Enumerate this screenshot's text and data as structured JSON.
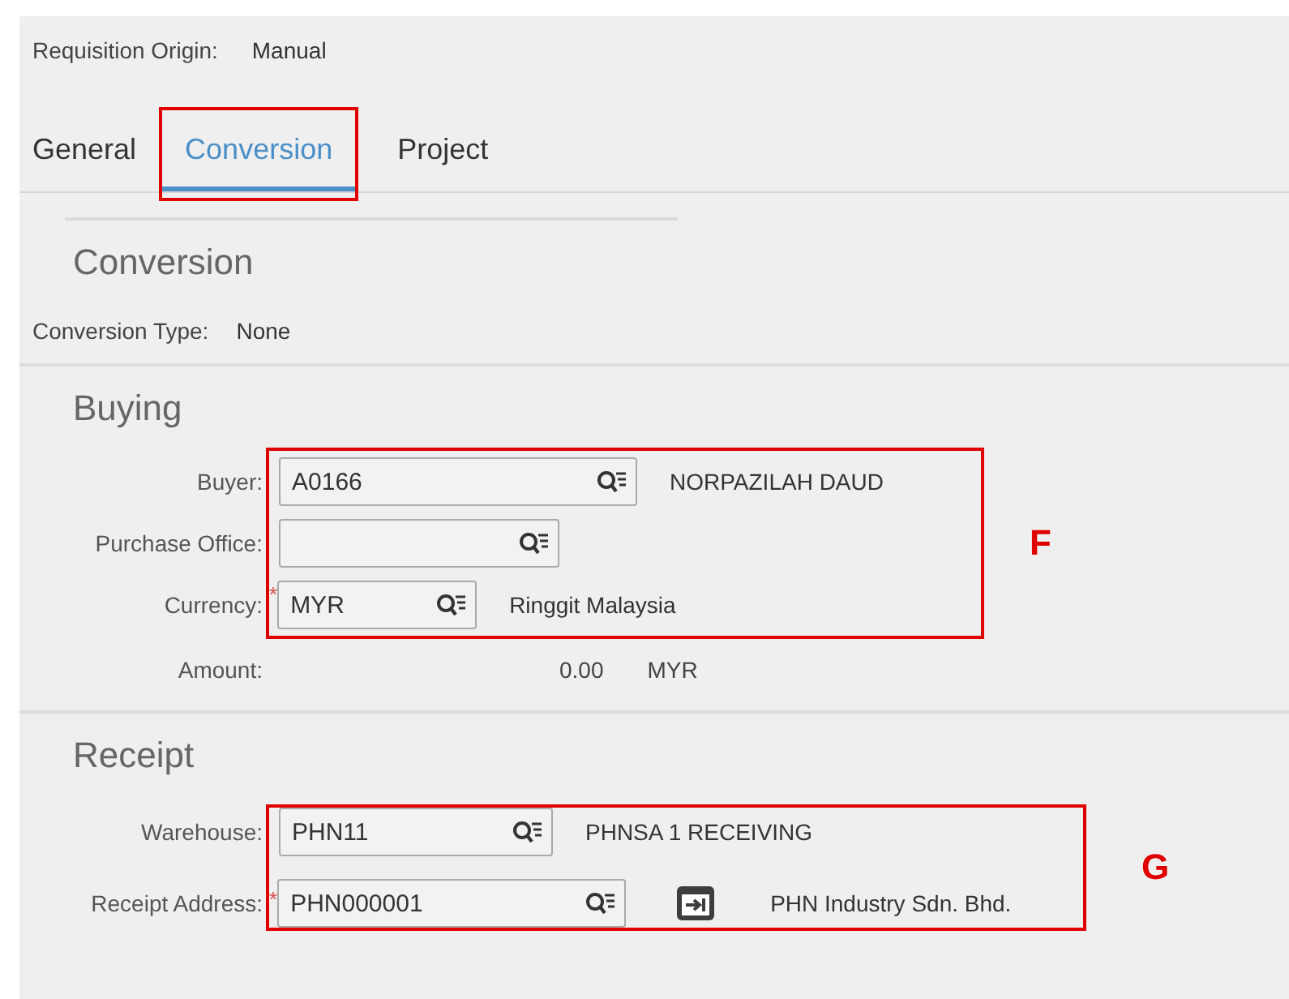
{
  "header": {
    "label": "Requisition Origin:",
    "value": "Manual"
  },
  "tabs": [
    {
      "label": "General",
      "selected": false,
      "highlighted": false
    },
    {
      "label": "Conversion",
      "selected": true,
      "highlighted": true
    },
    {
      "label": "Project",
      "selected": false,
      "highlighted": false
    }
  ],
  "conversion": {
    "title": "Conversion",
    "type_label": "Conversion Type:",
    "type_value": "None"
  },
  "sections": [
    {
      "title": "Buying",
      "annotation": "F",
      "annotated_rows": [
        {
          "kind": "lookup",
          "label": "Buyer:",
          "value": "A0166",
          "description": "NORPAZILAH DAUD"
        },
        {
          "kind": "lookup",
          "label": "Purchase Office:",
          "value": ""
        },
        {
          "kind": "lookup",
          "label": "Currency:",
          "required_mark": "*",
          "value": "MYR",
          "description": "Ringgit Malaysia"
        }
      ],
      "rows": [
        {
          "kind": "amount",
          "label": "Amount:",
          "value": "0.00",
          "unit": "MYR"
        }
      ]
    },
    {
      "title": "Receipt",
      "annotation": "G",
      "annotated_rows": [
        {
          "kind": "lookup",
          "label": "Warehouse:",
          "value": "PHN11",
          "description": "PHNSA 1 RECEIVING"
        },
        {
          "kind": "lookup",
          "label": "Receipt Address:",
          "required_mark": "*",
          "value": "PHN000001",
          "description": "PHN Industry Sdn. Bhd.",
          "action_button": true
        }
      ]
    }
  ]
}
